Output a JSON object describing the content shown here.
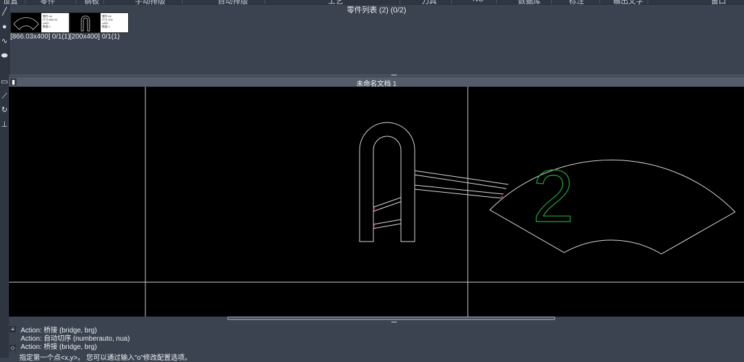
{
  "top_menu": [
    "设置",
    "零件",
    "钢板",
    "手动排版",
    "自动排版",
    "工艺",
    "刀具",
    "NC",
    "数据库",
    "标注",
    "输出文字",
    "窗口"
  ],
  "left_toolbar": {
    "tools": [
      {
        "name": "line-tool-icon",
        "glyph": "╱"
      },
      {
        "name": "circle-tool-icon",
        "glyph": "●"
      },
      {
        "name": "spline-tool-icon",
        "glyph": "∿"
      },
      {
        "name": "ellipse-tool-icon",
        "glyph": "⬬"
      },
      {
        "name": "rect-tool-icon",
        "glyph": "▭"
      },
      {
        "name": "polyline-tool-icon",
        "glyph": "⟋"
      },
      {
        "name": "rotate-tool-icon",
        "glyph": "↻"
      },
      {
        "name": "dimension-tool-icon",
        "glyph": "⊥"
      }
    ]
  },
  "parts_list": {
    "title": "零件列表 (2) (0/2)",
    "items": [
      {
        "label": "[866.03x400] 0/1(1)",
        "info": [
          "零件:1#",
          "尺寸:866.03",
          "x400",
          "数量:1"
        ]
      },
      {
        "label": "[200x400] 0/1(1)",
        "info": [
          "零件:2#",
          "尺寸:200",
          "x400",
          "数量:1"
        ]
      }
    ]
  },
  "document": {
    "tab_title": "未命名文档 1",
    "part_number_label": "2"
  },
  "console": {
    "lines": [
      "Action: 桥接 (bridge, brg)",
      "Action: 自动切序 (numberauto, nua)",
      "Action: 桥接 (bridge, brg)"
    ],
    "prompt": "指定第一个点<x,y>。 您可以通过输入\"o\"修改配置选项。"
  },
  "colors": {
    "canvas_bg": "#000000",
    "part_outline": "#dcdcdc",
    "part_number": "#1faa3a",
    "bridge_mark": "#d23a3a"
  }
}
